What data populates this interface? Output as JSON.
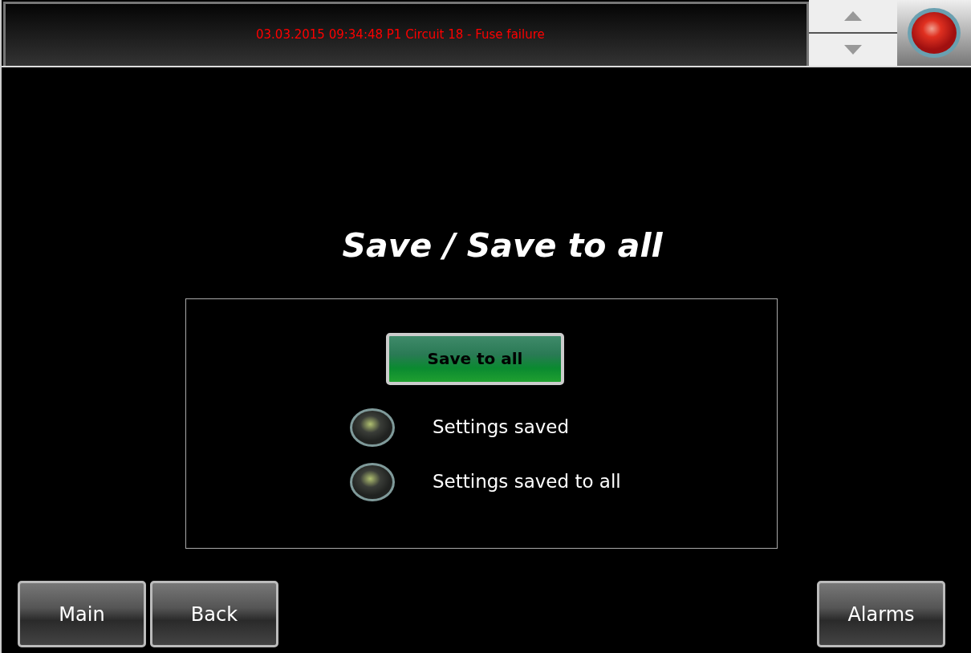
{
  "alarm_banner": {
    "message": "03.03.2015 09:34:48 P1 Circuit 18 - Fuse failure"
  },
  "alarm_lamp": {
    "on": true
  },
  "title": "Save / Save to all",
  "save_button": {
    "label": "Save to all"
  },
  "indicators": [
    {
      "label": "Settings saved",
      "on": false
    },
    {
      "label": "Settings saved to all",
      "on": false
    }
  ],
  "nav_buttons": [
    "Main",
    "Back"
  ],
  "alarms_button": "Alarms"
}
